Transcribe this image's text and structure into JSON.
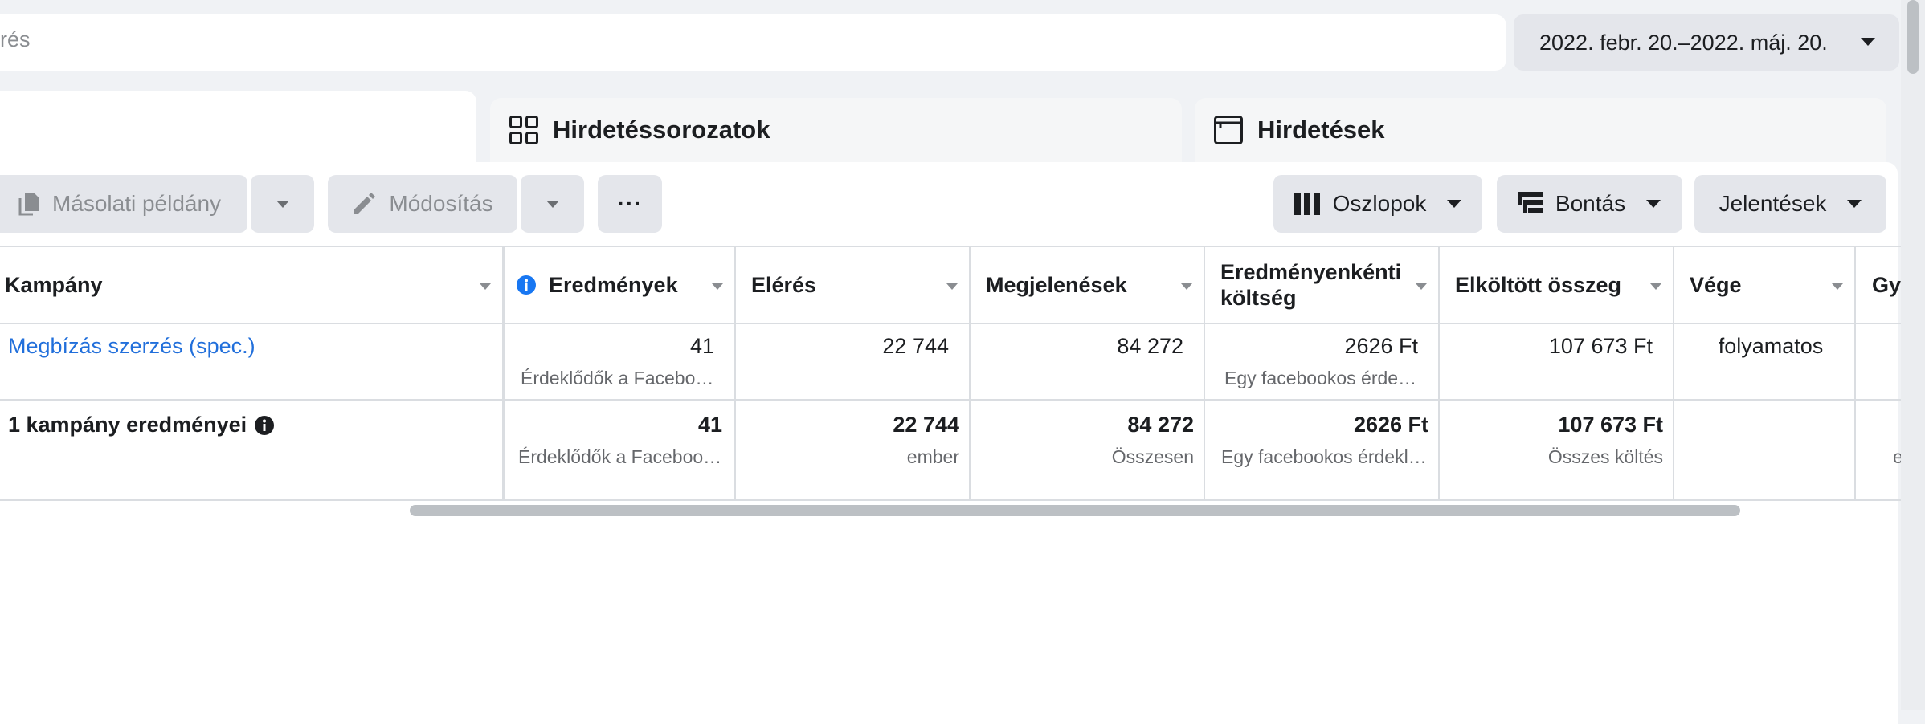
{
  "search": {
    "text": "rés"
  },
  "date_range": {
    "label": "2022. febr. 20.–2022. máj. 20."
  },
  "tabs": [
    {
      "label": "Hirdetéssorozatok",
      "icon": "grid-icon"
    },
    {
      "label": "Hirdetések",
      "icon": "ad-window-icon"
    }
  ],
  "toolbar": {
    "duplicate_label": "Másolati példány",
    "edit_label": "Módosítás",
    "more_label": "···",
    "columns_label": "Oszlopok",
    "breakdown_label": "Bontás",
    "reports_label": "Jelentések"
  },
  "table": {
    "headers": {
      "campaign": "Kampány",
      "results": "Eredmények",
      "reach": "Elérés",
      "impressions": "Megjelenések",
      "cost_per_result_line1": "Eredményenkénti",
      "cost_per_result_line2": "költség",
      "amount_spent": "Elköltött összeg",
      "end": "Vége",
      "truncated": "Gy"
    },
    "row": {
      "campaign": "Megbízás szerzés (spec.)",
      "results": "41",
      "results_sub": "Érdeklődők a Facebo…",
      "reach": "22 744",
      "impressions": "84 272",
      "cost_per_result": "2626 Ft",
      "cost_per_result_sub": "Egy facebookos érde…",
      "amount_spent": "107 673 Ft",
      "end": "folyamatos"
    },
    "summary": {
      "label": "1 kampány eredményei",
      "results": "41",
      "results_sub": "Érdeklődők a Faceboo…",
      "reach": "22 744",
      "reach_sub": "ember",
      "impressions": "84 272",
      "impressions_sub": "Összesen",
      "cost_per_result": "2626 Ft",
      "cost_per_result_sub": "Egy facebookos érdekl…",
      "amount_spent": "107 673 Ft",
      "amount_spent_sub": "Összes költés",
      "truncated_sub": "e"
    }
  }
}
